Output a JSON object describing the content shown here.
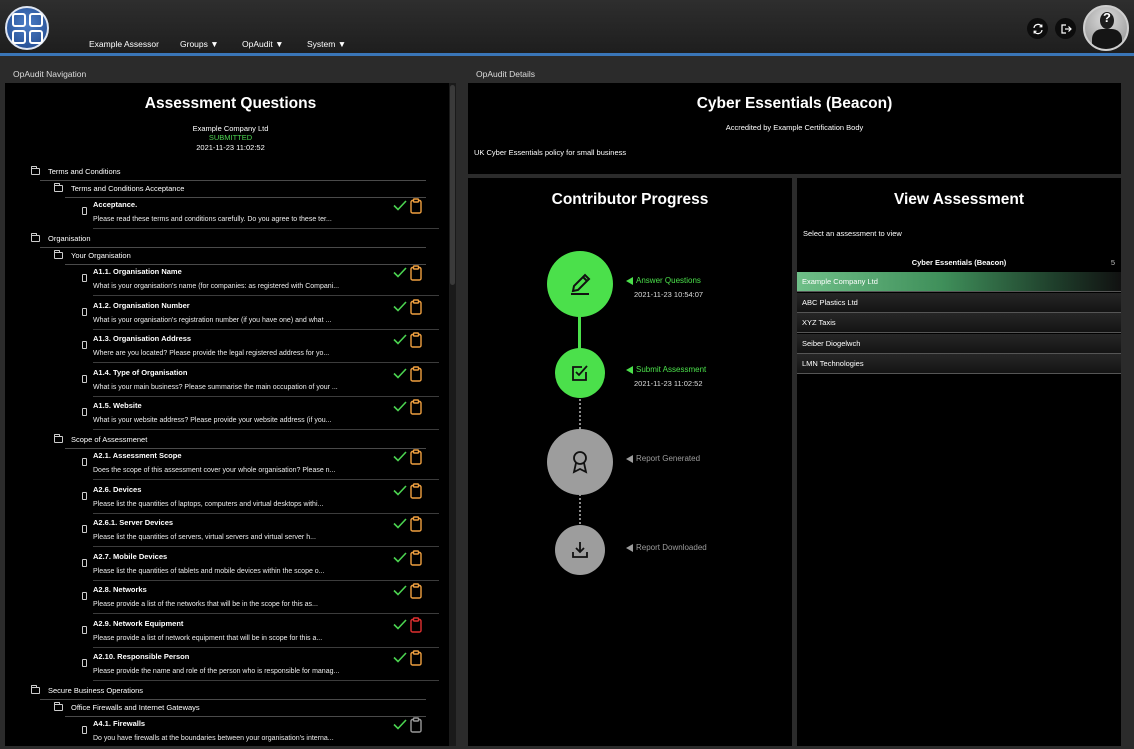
{
  "header": {
    "nav": [
      "Example Assessor",
      "Groups ▼",
      "OpAudit ▼",
      "System ▼"
    ]
  },
  "left_panel": {
    "header": "OpAudit Navigation",
    "title": "Assessment Questions",
    "company": "Example Company Ltd",
    "status": "SUBMITTED",
    "datetime": "2021-11-23 11:02:52",
    "groups": [
      {
        "label": "Terms and Conditions"
      },
      {
        "label": "Organisation"
      },
      {
        "label": "Secure Business Operations"
      }
    ],
    "subgroups": [
      {
        "label": "Terms and Conditions Acceptance"
      },
      {
        "label": "Your Organisation"
      },
      {
        "label": "Scope of Assessmenet"
      },
      {
        "label": "Office Firewalls and Internet Gateways"
      }
    ],
    "questions": [
      {
        "title": "Acceptance.",
        "desc": "Please read these terms and conditions carefully. Do you agree to these ter...",
        "clip_color": "#f0a040"
      },
      {
        "title": "A1.1. Organisation Name",
        "desc": "What is your organisation's name (for companies: as registered with Compani...",
        "clip_color": "#f0a040"
      },
      {
        "title": "A1.2. Organisation Number",
        "desc": "What is your organisation's registration number (if you have one) and what ...",
        "clip_color": "#f0a040"
      },
      {
        "title": "A1.3. Organisation Address",
        "desc": "Where are you located? Please provide the legal registered address for yo...",
        "clip_color": "#f0a040"
      },
      {
        "title": "A1.4. Type of Organisation",
        "desc": "What is your main business? Please summarise the main occupation of your ...",
        "clip_color": "#f0a040"
      },
      {
        "title": "A1.5. Website",
        "desc": "What is your website address? Please provide your website address (if you...",
        "clip_color": "#f0a040"
      },
      {
        "title": "A2.1. Assessment Scope",
        "desc": "Does the scope of this assessment cover your whole organisation? Please n...",
        "clip_color": "#f0a040"
      },
      {
        "title": "A2.6. Devices",
        "desc": "Please list the quantities of laptops, computers and virtual desktops withi...",
        "clip_color": "#f0a040"
      },
      {
        "title": "A2.6.1. Server Devices",
        "desc": "Please list the quantities of servers, virtual servers and virtual server h...",
        "clip_color": "#f0a040"
      },
      {
        "title": "A2.7. Mobile Devices",
        "desc": "Please list the quantities of tablets and mobile devices within the scope o...",
        "clip_color": "#f0a040"
      },
      {
        "title": "A2.8. Networks",
        "desc": "Please provide a list of the networks that will be in the scope for this as...",
        "clip_color": "#f0a040"
      },
      {
        "title": "A2.9. Network Equipment",
        "desc": "Please provide a list of network equipment that will be in scope for this a...",
        "clip_color": "#e03030"
      },
      {
        "title": "A2.10. Responsible Person",
        "desc": "Please provide the name and role of the person who is responsible for manag...",
        "clip_color": "#f0a040"
      },
      {
        "title": "A4.1. Firewalls",
        "desc": "Do you have firewalls at the boundaries between your organisation's interna...",
        "clip_color": "#9a9a9a"
      }
    ]
  },
  "details": {
    "header": "OpAudit Details",
    "title": "Cyber Essentials (Beacon)",
    "accredited": "Accredited by Example Certification Body",
    "description": "UK Cyber Essentials policy for small business"
  },
  "progress": {
    "title": "Contributor Progress",
    "steps": [
      {
        "label": "Answer Questions",
        "date": "2021-11-23 10:54:07",
        "state": "done",
        "icon": "pen-icon"
      },
      {
        "label": "Submit Assessment",
        "date": "2021-11-23 11:02:52",
        "state": "done",
        "icon": "checkbox-icon"
      },
      {
        "label": "Report Generated",
        "date": "",
        "state": "pending",
        "icon": "award-icon"
      },
      {
        "label": "Report Downloaded",
        "date": "",
        "state": "pending",
        "icon": "download-icon"
      }
    ]
  },
  "view_assessment": {
    "title": "View Assessment",
    "hint": "Select an assessment to view",
    "list_title": "Cyber Essentials (Beacon)",
    "count": "5",
    "items": [
      {
        "label": "Example Company Ltd",
        "selected": true
      },
      {
        "label": "ABC Plastics Ltd",
        "selected": false
      },
      {
        "label": "XYZ Taxis",
        "selected": false
      },
      {
        "label": "Seiber Diogelwch",
        "selected": false
      },
      {
        "label": "LMN Technologies",
        "selected": false
      }
    ]
  },
  "colors": {
    "accent_blue": "#3a76b8",
    "done_green": "#4be04b",
    "pending_grey": "#9d9d9d",
    "check_green": "#4bd350"
  }
}
